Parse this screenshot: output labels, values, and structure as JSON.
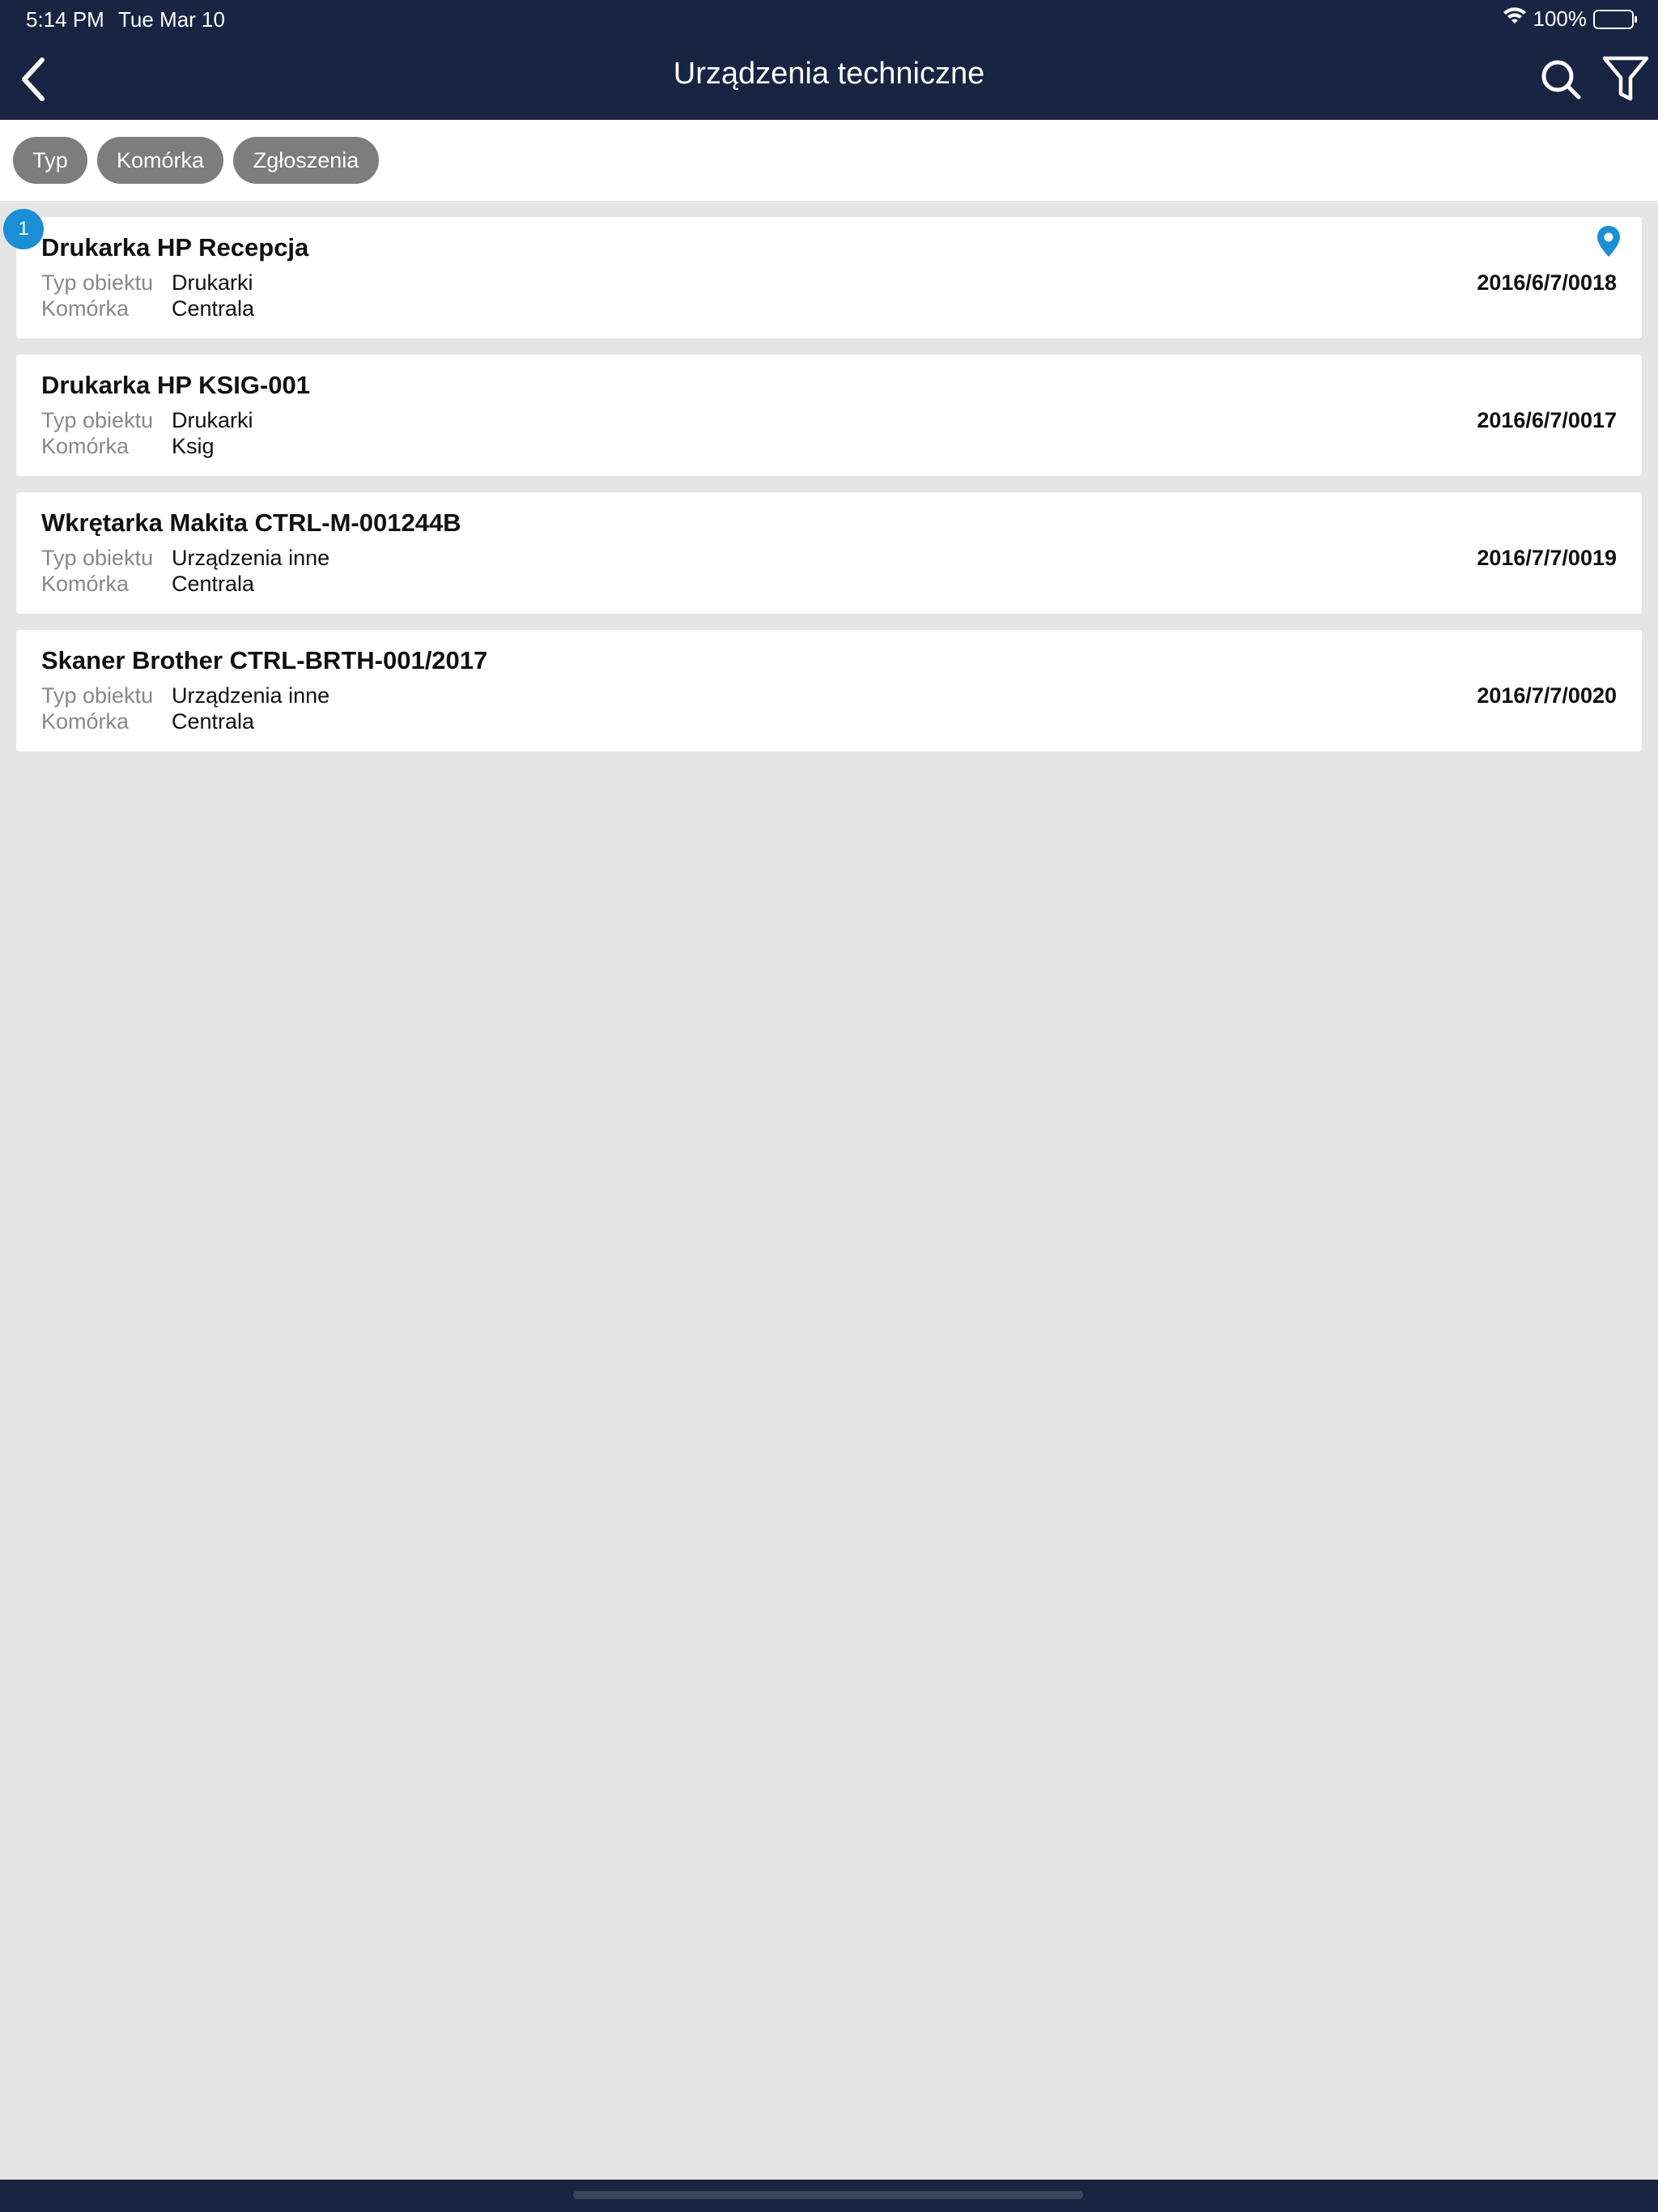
{
  "status_bar": {
    "time": "5:14 PM",
    "date": "Tue Mar 10",
    "battery": "100%",
    "icons": [
      "wifi-icon",
      "battery-icon"
    ]
  },
  "header": {
    "title": "Urządzenia techniczne",
    "icons": [
      "back-chevron-icon",
      "search-icon",
      "filter-icon"
    ]
  },
  "filters": {
    "chips": [
      {
        "label": "Typ"
      },
      {
        "label": "Komórka"
      },
      {
        "label": "Zgłoszenia"
      }
    ]
  },
  "badge_count": "1",
  "items": [
    {
      "title": "Drukarka HP Recepcja",
      "type_label": "Typ obiektu",
      "type_value": "Drukarki",
      "cell_label": "Komórka",
      "cell_value": "Centrala",
      "code": "2016/6/7/0018",
      "location_icon": "location-pin-icon"
    },
    {
      "title": "Drukarka HP KSIG-001",
      "type_label": "Typ obiektu",
      "type_value": "Drukarki",
      "cell_label": "Komórka",
      "cell_value": "Ksig",
      "code": "2016/6/7/0017"
    },
    {
      "title": "Wkrętarka Makita CTRL-M-001244B",
      "type_label": "Typ obiektu",
      "type_value": "Urządzenia inne",
      "cell_label": "Komórka",
      "cell_value": "Centrala",
      "code": "2016/7/7/0019"
    },
    {
      "title": "Skaner Brother CTRL-BRTH-001/2017",
      "type_label": "Typ obiektu",
      "type_value": "Urządzenia inne",
      "cell_label": "Komórka",
      "cell_value": "Centrala",
      "code": "2016/7/7/0020"
    }
  ],
  "colors": {
    "header_bg": "#182442",
    "page_bg": "#e5e5e5",
    "chip_bg": "#7d7d7d",
    "accent": "#1a8fd6"
  }
}
